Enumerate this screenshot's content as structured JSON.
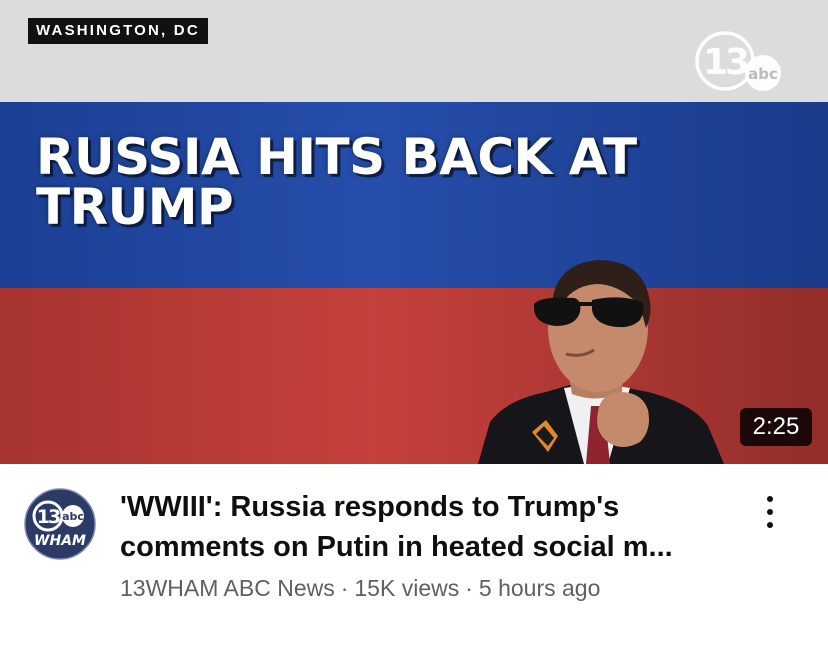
{
  "thumbnail": {
    "location_tag": "WASHINGTON, DC",
    "headline_line1": "RUSSIA HITS BACK AT",
    "headline_line2": "TRUMP",
    "logo_number": "13",
    "logo_network": "abc",
    "duration": "2:25",
    "colors": {
      "flag_white": "#dcdcdd",
      "flag_blue": "#1f48a8",
      "flag_red": "#c43d38"
    }
  },
  "channel": {
    "avatar_number": "13",
    "avatar_network": "abc",
    "avatar_callsign": "WHAM"
  },
  "video": {
    "title": "'WWIII': Russia responds to Trump's comments on Putin in heated social m...",
    "channel_name": "13WHAM ABC News",
    "views": "15K views",
    "age": "5 hours ago",
    "separator": "·"
  },
  "icons": {
    "more": "more-vertical-icon"
  }
}
